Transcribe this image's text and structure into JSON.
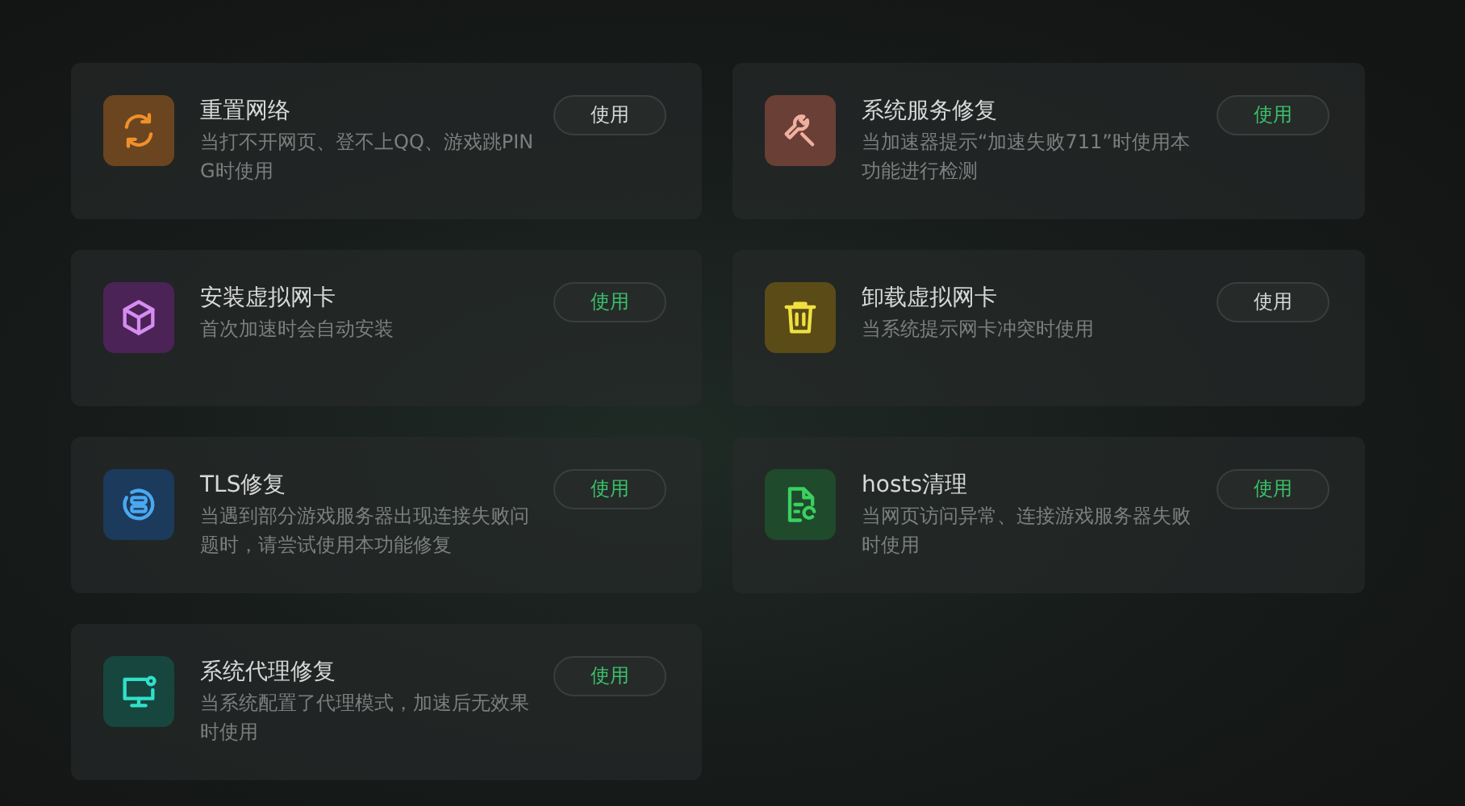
{
  "tools": [
    {
      "kind": "refresh",
      "color": "#6b4520",
      "title": "重置网络",
      "description": "当打不开网页、登不上QQ、游戏跳PING时使用",
      "button": "使用",
      "highlighted": false
    },
    {
      "kind": "wrench",
      "color": "#6a3f36",
      "title": "系统服务修复",
      "description": "当加速器提示“加速失败711”时使用本功能进行检测",
      "button": "使用",
      "highlighted": true
    },
    {
      "kind": "cube",
      "color": "#4b2357",
      "title": "安装虚拟网卡",
      "description": "首次加速时会自动安装",
      "button": "使用",
      "highlighted": true
    },
    {
      "kind": "trash",
      "color": "#5a4b17",
      "title": "卸载虚拟网卡",
      "description": "当系统提示网卡冲突时使用",
      "button": "使用",
      "highlighted": false
    },
    {
      "kind": "tls",
      "color": "#1c3a5c",
      "title": "TLS修复",
      "description": "当遇到部分游戏服务器出现连接失败问题时，请尝试使用本功能修复",
      "button": "使用",
      "highlighted": true
    },
    {
      "kind": "file",
      "color": "#1f4a2c",
      "title": "hosts清理",
      "description": "当网页访问异常、连接游戏服务器失败时使用",
      "button": "使用",
      "highlighted": true
    },
    {
      "kind": "monitor",
      "color": "#17463e",
      "title": "系统代理修复",
      "description": "当系统配置了代理模式，加速后无效果时使用",
      "button": "使用",
      "highlighted": true
    }
  ]
}
